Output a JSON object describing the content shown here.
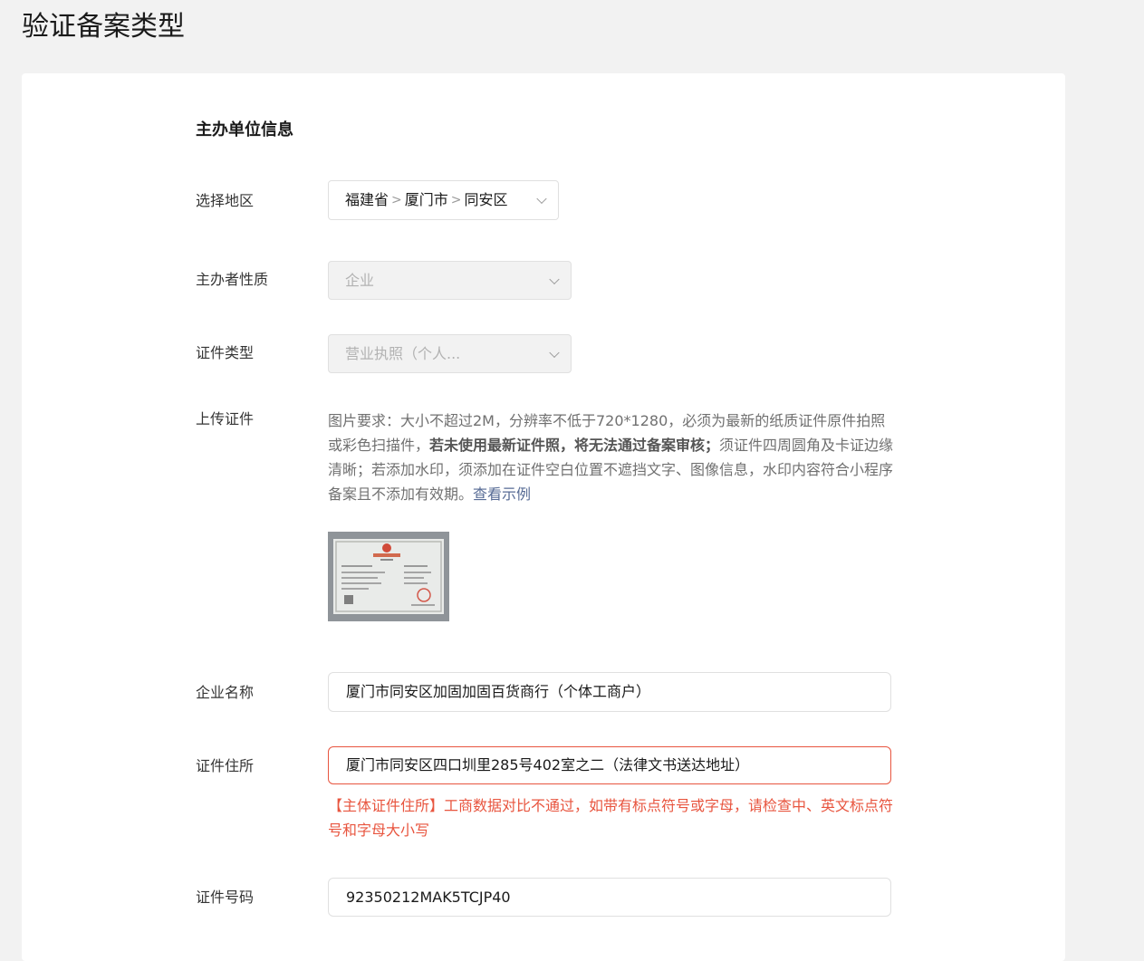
{
  "page": {
    "title": "验证备案类型"
  },
  "section": {
    "title": "主办单位信息"
  },
  "region": {
    "label": "选择地区",
    "province": "福建省",
    "city": "厦门市",
    "district": "同安区",
    "separator": ">"
  },
  "nature": {
    "label": "主办者性质",
    "value": "企业"
  },
  "cert_type": {
    "label": "证件类型",
    "value": "营业执照（个人..."
  },
  "upload": {
    "label": "上传证件",
    "help_part1": "图片要求：大小不超过2M，分辨率不低于720*1280，必须为最新的纸质证件原件拍照或彩色扫描件，",
    "help_bold": "若未使用最新证件照，将无法通过备案审核；",
    "help_part2": "须证件四周圆角及卡证边缘清晰；若添加水印，须添加在证件空白位置不遮挡文字、图像信息，水印内容符合小程序备案且不添加有效期。",
    "help_link": "查看示例",
    "thumbnail_title": "营业执照"
  },
  "company_name": {
    "label": "企业名称",
    "value": "厦门市同安区加固加固百货商行（个体工商户）"
  },
  "address": {
    "label": "证件住所",
    "value": "厦门市同安区四口圳里285号402室之二（法律文书送达地址）",
    "error": "【主体证件住所】工商数据对比不通过，如带有标点符号或字母，请检查中、英文标点符号和字母大小写"
  },
  "cert_number": {
    "label": "证件号码",
    "value": "92350212MAK5TCJP40"
  },
  "colors": {
    "background": "#f2f2f2",
    "card": "#ffffff",
    "error": "#e8553f",
    "link": "#576b95",
    "disabled_bg": "#f2f2f2"
  }
}
